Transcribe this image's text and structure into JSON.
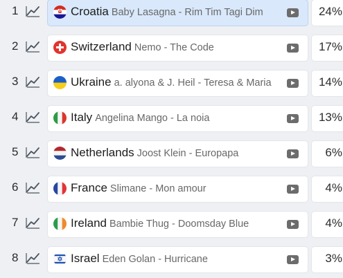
{
  "colors": {
    "background": "#eef0f3",
    "card": "#ffffff",
    "card_active": "#d9e8fb",
    "trend_icon": "#4c5560",
    "play_icon": "#6c6c6c"
  },
  "rows": [
    {
      "rank": "1",
      "country": "Croatia",
      "song": "Baby Lasagna - Rim Tim Tagi Dim",
      "percent": "24%",
      "flag": "croatia-flag",
      "active": true
    },
    {
      "rank": "2",
      "country": "Switzerland",
      "song": "Nemo - The Code",
      "percent": "17%",
      "flag": "switzerland-flag",
      "active": false
    },
    {
      "rank": "3",
      "country": "Ukraine",
      "song": "a. alyona & J. Heil - Teresa & Maria",
      "percent": "14%",
      "flag": "ukraine-flag",
      "active": false
    },
    {
      "rank": "4",
      "country": "Italy",
      "song": "Angelina Mango - La noia",
      "percent": "13%",
      "flag": "italy-flag",
      "active": false
    },
    {
      "rank": "5",
      "country": "Netherlands",
      "song": "Joost Klein - Europapa",
      "percent": "6%",
      "flag": "netherlands-flag",
      "active": false
    },
    {
      "rank": "6",
      "country": "France",
      "song": "Slimane - Mon amour",
      "percent": "4%",
      "flag": "france-flag",
      "active": false
    },
    {
      "rank": "7",
      "country": "Ireland",
      "song": "Bambie Thug - Doomsday Blue",
      "percent": "4%",
      "flag": "ireland-flag",
      "active": false
    },
    {
      "rank": "8",
      "country": "Israel",
      "song": "Eden Golan - Hurricane",
      "percent": "3%",
      "flag": "israel-flag",
      "active": false
    }
  ]
}
